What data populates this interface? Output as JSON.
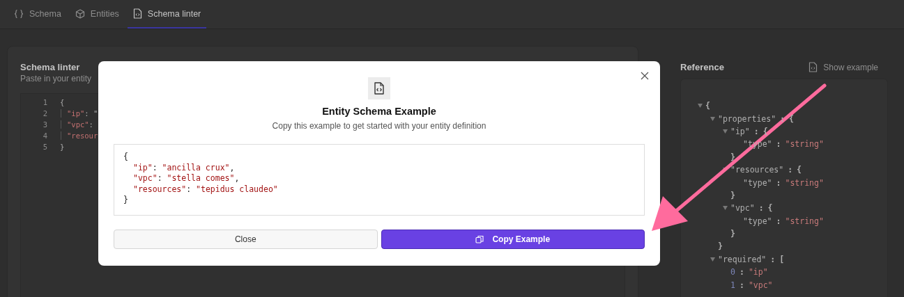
{
  "tabs": [
    {
      "label": "Schema",
      "selected": false
    },
    {
      "label": "Entities",
      "selected": false
    },
    {
      "label": "Schema linter",
      "selected": true
    }
  ],
  "linter": {
    "title": "Schema linter",
    "subtitle": "Paste in your entity",
    "lines": [
      {
        "number": "1",
        "kind": "brace",
        "parts": [
          {
            "kind": "punct",
            "text": "{"
          }
        ]
      },
      {
        "number": "2",
        "kind": "entry",
        "parts": [
          {
            "kind": "key",
            "text": "\"ip\""
          },
          {
            "kind": "punct",
            "text": ": \""
          }
        ]
      },
      {
        "number": "3",
        "kind": "entry",
        "parts": [
          {
            "kind": "key",
            "text": "\"vpc\""
          },
          {
            "kind": "punct",
            "text": ":"
          }
        ]
      },
      {
        "number": "4",
        "kind": "entry",
        "parts": [
          {
            "kind": "key",
            "text": "\"resour"
          }
        ]
      },
      {
        "number": "5",
        "kind": "brace",
        "parts": [
          {
            "kind": "punct",
            "text": "}"
          }
        ]
      }
    ]
  },
  "reference": {
    "title": "Reference",
    "action": "Show example",
    "tree": {
      "open": "{",
      "expanded": true,
      "children": [
        {
          "key": "\"properties\"",
          "sep": ":",
          "open": "{",
          "close": "}",
          "expanded": true,
          "children": [
            {
              "key": "\"ip\"",
              "sep": ":",
              "open": "{",
              "close": "}",
              "expanded": true,
              "children": [
                {
                  "key": "\"type\"",
                  "sep": ":",
                  "value": "\"string\""
                }
              ]
            },
            {
              "key": "\"resources\"",
              "sep": ":",
              "open": "{",
              "close": "}",
              "expanded": true,
              "children": [
                {
                  "key": "\"type\"",
                  "sep": ":",
                  "value": "\"string\""
                }
              ]
            },
            {
              "key": "\"vpc\"",
              "sep": ":",
              "open": "{",
              "close": "}",
              "expanded": true,
              "children": [
                {
                  "key": "\"type\"",
                  "sep": ":",
                  "value": "\"string\""
                }
              ]
            }
          ]
        },
        {
          "key": "\"required\"",
          "sep": ":",
          "open": "[",
          "expanded": true,
          "children": [
            {
              "kind": "index",
              "key": "0",
              "sep": ":",
              "value": "\"ip\""
            },
            {
              "kind": "index",
              "key": "1",
              "sep": ":",
              "value": "\"vpc\""
            }
          ]
        }
      ]
    }
  },
  "dialog": {
    "title": "Entity Schema Example",
    "subtitle": "Copy this example to get started with your entity definition",
    "code": {
      "open": "{",
      "close": "}",
      "entries": [
        [
          {
            "kind": "key",
            "text": "\"ip\""
          },
          {
            "kind": "punct",
            "text": ": "
          },
          {
            "kind": "string",
            "text": "\"ancilla crux\""
          },
          {
            "kind": "punct",
            "text": ","
          }
        ],
        [
          {
            "kind": "key",
            "text": "\"vpc\""
          },
          {
            "kind": "punct",
            "text": ": "
          },
          {
            "kind": "string",
            "text": "\"stella comes\""
          },
          {
            "kind": "punct",
            "text": ","
          }
        ],
        [
          {
            "kind": "key",
            "text": "\"resources\""
          },
          {
            "kind": "punct",
            "text": ": "
          },
          {
            "kind": "string",
            "text": "\"tepidus claudeo\""
          }
        ]
      ]
    },
    "buttons": [
      {
        "label": "Close",
        "kind": "secondary"
      },
      {
        "label": "Copy Example",
        "kind": "primary"
      }
    ]
  }
}
